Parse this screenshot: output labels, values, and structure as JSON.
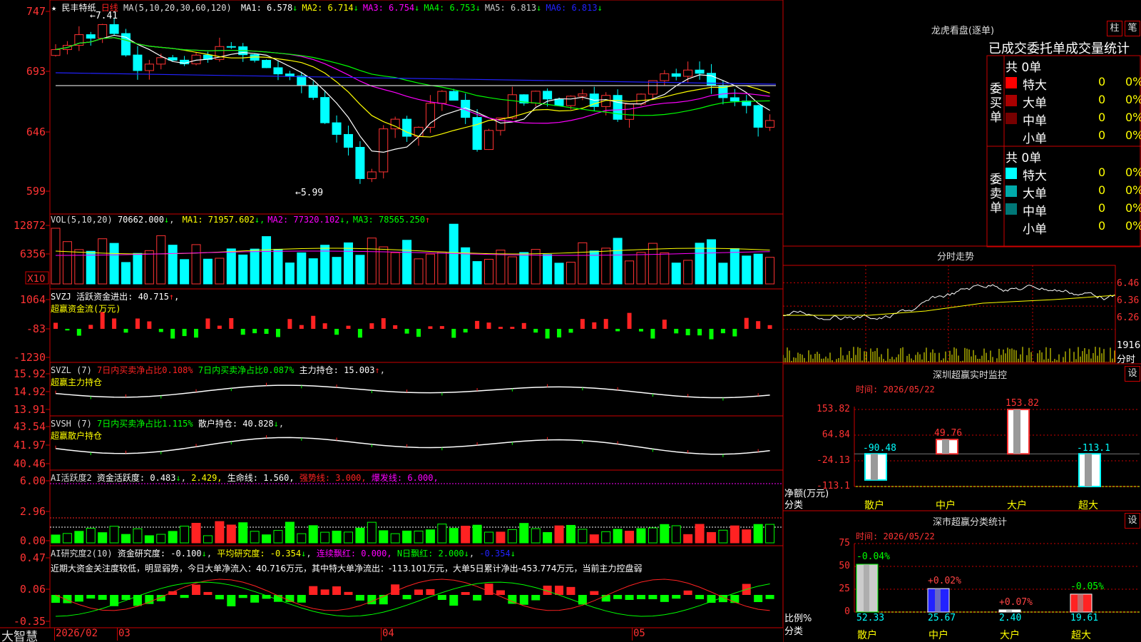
{
  "app": {
    "brand": "大智慧"
  },
  "kline": {
    "stock_name": "民丰特纸",
    "period": "日线",
    "ma_label": "MA(5,10,20,30,60,120)",
    "ma": [
      {
        "label": "MA1:",
        "value": "6.578",
        "color": "#ffffff"
      },
      {
        "label": "MA2:",
        "value": "6.714",
        "color": "#ffff00"
      },
      {
        "label": "MA3:",
        "value": "6.754",
        "color": "#ff00ff"
      },
      {
        "label": "MA4:",
        "value": "6.753",
        "color": "#00ff00"
      },
      {
        "label": "MA5:",
        "value": "6.813",
        "color": "#cccccc"
      },
      {
        "label": "MA6:",
        "value": "6.813",
        "color": "#2222ff"
      }
    ],
    "yticks": [
      "747",
      "693",
      "646",
      "599"
    ],
    "high_label": "7.41",
    "low_label": "5.99"
  },
  "vol": {
    "label": "VOL(5,10,20)",
    "value": "70662.000",
    "ma": [
      {
        "label": "MA1:",
        "value": "71957.602",
        "color": "#ffff00"
      },
      {
        "label": "MA2:",
        "value": "77320.102",
        "color": "#ff00ff"
      },
      {
        "label": "MA3:",
        "value": "78565.250",
        "color": "#00ff00"
      }
    ],
    "yticks": [
      "12872",
      "6356"
    ],
    "unit": "X10"
  },
  "svzj": {
    "line1": "SVZJ  活跃资金进出: 40.715",
    "line2": "超赢资金流(万元)",
    "yticks": [
      "1064",
      "-83",
      "-1230"
    ]
  },
  "svzl": {
    "name": "SVZL (7)",
    "t1": "7日内买卖净占比0.108%",
    "t2": "7日内买卖净占比0.087%",
    "t3": "主力持仓: 15.003",
    "line2": "超赢主力持仓",
    "yticks": [
      "15.92",
      "14.92",
      "13.91"
    ]
  },
  "svsh": {
    "name": "SVSH (7)",
    "t1": "7日内买卖净占比1.115%",
    "t2": "散户持仓: 40.828",
    "line2": "超赢散户持仓",
    "yticks": [
      "43.54",
      "41.97",
      "40.46"
    ]
  },
  "ai1": {
    "name": "AI活跃度2",
    "t1": "资金活跃度: 0.483",
    "t2": "2.429,",
    "t3": "生命线: 1.560,",
    "t4": "强势线: 3.000,",
    "t5": "爆发线: 6.000,",
    "yticks": [
      "6.00",
      "2.96",
      "0.00"
    ]
  },
  "ai2": {
    "name": "AI研究度2(10)",
    "t1": "资金研究度: -0.100",
    "t2": "平均研究度: -0.354",
    "t3": "连续飘红: 0.000,",
    "t4": "N日飘红: 2.000",
    "t5": "-0.354",
    "comment": "近期大资金关注度较低，明显弱势，今日大单净流入：40.716万元，其中特大单净流出：-113.101万元，大单5日累计净出-453.774万元，当前主力控盘弱",
    "yticks": [
      "0.47",
      "0.06",
      "-0.35"
    ]
  },
  "xaxis": {
    "labels": [
      "2026/02",
      "03",
      "04",
      "05"
    ]
  },
  "longhu": {
    "title": "龙虎看盘(逐单)",
    "btn1": "柱",
    "btn2": "笔",
    "subtitle": "已成交委托单成交量统计",
    "buy": {
      "side_label": [
        "委",
        "买",
        "单"
      ],
      "total": "共 0单",
      "rows": [
        {
          "label": "特大",
          "count": "0",
          "pct": "0%",
          "color": "#ff0000"
        },
        {
          "label": "大单",
          "count": "0",
          "pct": "0%",
          "color": "#aa0000"
        },
        {
          "label": "中单",
          "count": "0",
          "pct": "0%",
          "color": "#770000"
        },
        {
          "label": "小单",
          "count": "0",
          "pct": "0%",
          "color": "#000000"
        }
      ]
    },
    "sell": {
      "side_label": [
        "委",
        "卖",
        "单"
      ],
      "total": "共 0单",
      "rows": [
        {
          "label": "特大",
          "count": "0",
          "pct": "0%",
          "color": "#00ffff"
        },
        {
          "label": "大单",
          "count": "0",
          "pct": "0%",
          "color": "#00aaaa"
        },
        {
          "label": "中单",
          "count": "0",
          "pct": "0%",
          "color": "#007777"
        },
        {
          "label": "小单",
          "count": "0",
          "pct": "0%",
          "color": "#000000"
        }
      ]
    }
  },
  "intraday": {
    "title": "分时走势",
    "yticks": [
      "6.46",
      "6.36",
      "6.26"
    ],
    "vol_label": "1916",
    "vol_unit": "分时"
  },
  "monitor": {
    "title": "深圳超赢实时监控",
    "settings": "设",
    "time": "时间: 2026/05/22",
    "yticks": [
      "153.82",
      "64.84",
      "-24.13",
      "-113.1"
    ],
    "ylabel": "净额(万元)",
    "xlabel": "分类",
    "bars": [
      {
        "label": "散户",
        "value": -90.48,
        "text": "-90.48"
      },
      {
        "label": "中户",
        "value": 49.76,
        "text": "49.76"
      },
      {
        "label": "大户",
        "value": 153.82,
        "text": "153.82"
      },
      {
        "label": "超大",
        "value": -113.1,
        "text": "-113.1"
      }
    ]
  },
  "classify": {
    "title": "深市超赢分类统计",
    "settings": "设",
    "time": "时间: 2026/05/22",
    "yticks": [
      "75",
      "50",
      "25",
      "0"
    ],
    "ylabel": "比例%",
    "xlabel": "分类",
    "bars": [
      {
        "label": "散户",
        "value": 52.33,
        "value_text": "52.33",
        "change": "-0.04%",
        "fill": "#cccccc",
        "change_color": "#00ff00"
      },
      {
        "label": "中户",
        "value": 25.67,
        "value_text": "25.67",
        "change": "+0.02%",
        "fill": "#2222ff",
        "change_color": "#ff4444"
      },
      {
        "label": "大户",
        "value": 2.4,
        "value_text": "2.40",
        "change": "+0.07%",
        "fill": "#ffffff",
        "change_color": "#ff4444"
      },
      {
        "label": "超大",
        "value": 19.61,
        "value_text": "19.61",
        "change": "-0.05%",
        "fill": "#ff2222",
        "change_color": "#00ff00"
      }
    ]
  }
}
